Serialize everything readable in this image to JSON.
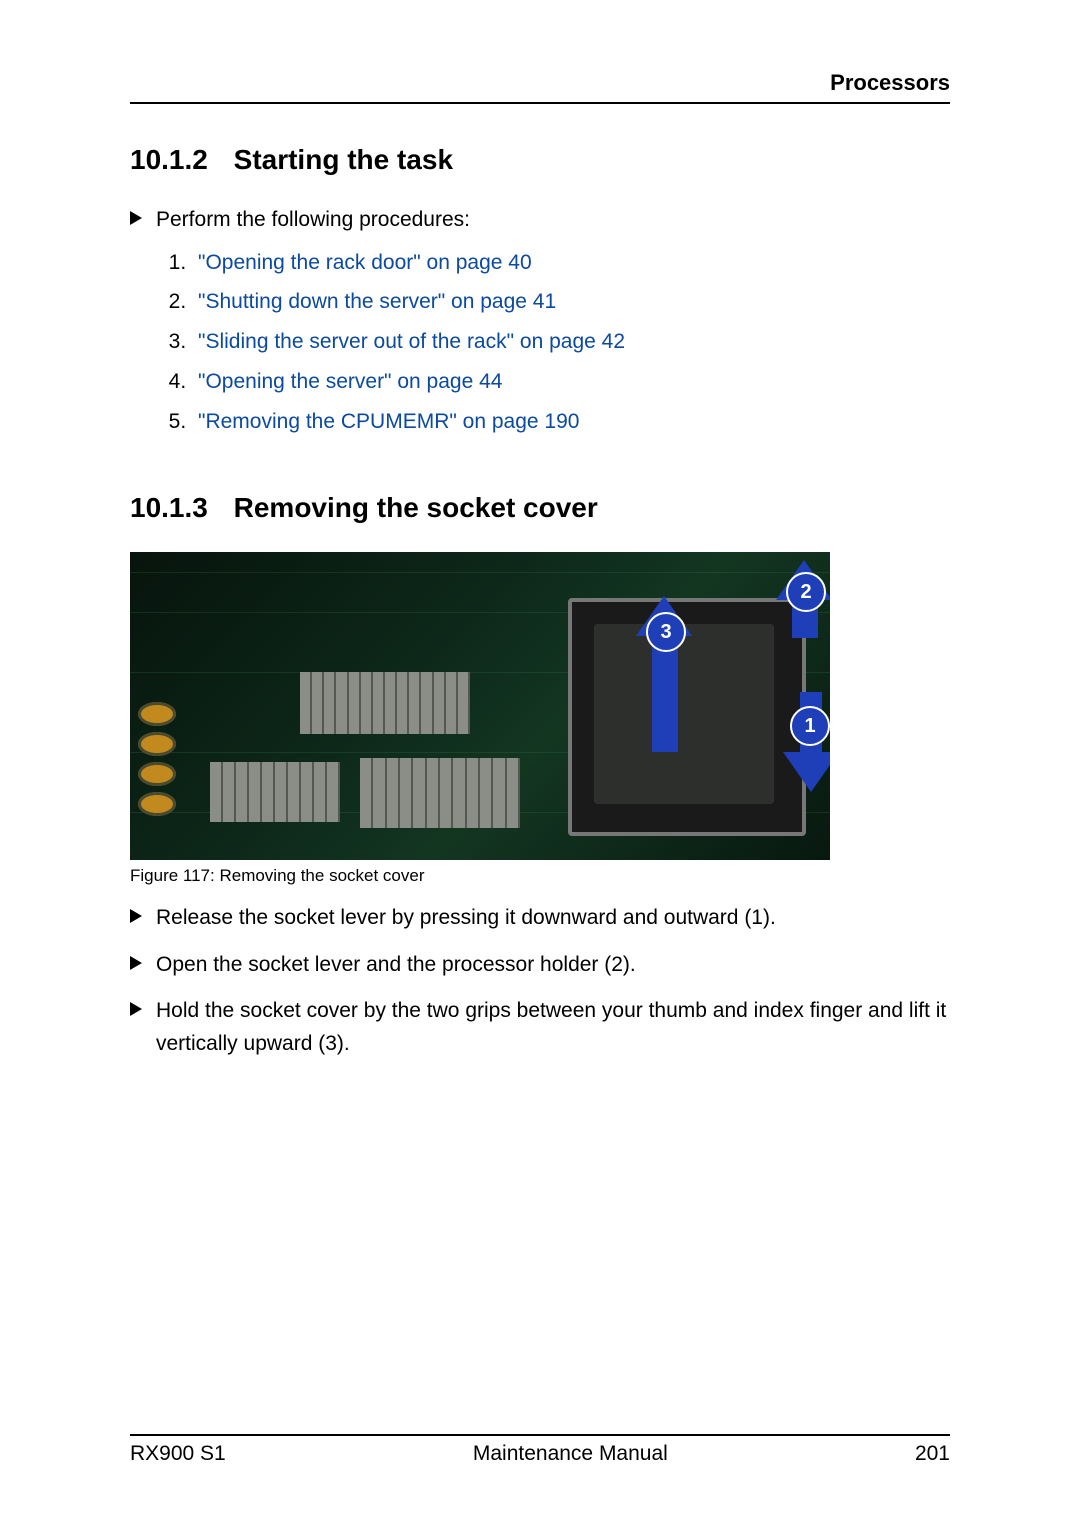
{
  "header": {
    "section": "Processors"
  },
  "s1": {
    "num": "10.1.2",
    "title": "Starting the task",
    "intro": "Perform the following procedures:"
  },
  "procedures": [
    {
      "text": "\"Opening the rack door\" on page 40"
    },
    {
      "text": "\"Shutting down the server\" on page 41"
    },
    {
      "text": "\"Sliding the server out of the rack\" on page 42"
    },
    {
      "text": "\"Opening the server\" on page 44"
    },
    {
      "text": "\"Removing the CPUMEMR\" on page 190"
    }
  ],
  "s2": {
    "num": "10.1.3",
    "title": "Removing the socket cover"
  },
  "figure": {
    "caption": "Figure 117: Removing the socket cover",
    "callouts": {
      "c1": "1",
      "c2": "2",
      "c3": "3"
    }
  },
  "steps": [
    "Release the socket lever by pressing it downward and outward (1).",
    "Open the socket lever and the processor holder (2).",
    "Hold the socket cover by the two grips between your thumb and index finger and lift it vertically upward (3)."
  ],
  "footer": {
    "left": "RX900 S1",
    "center": "Maintenance Manual",
    "right": "201"
  }
}
